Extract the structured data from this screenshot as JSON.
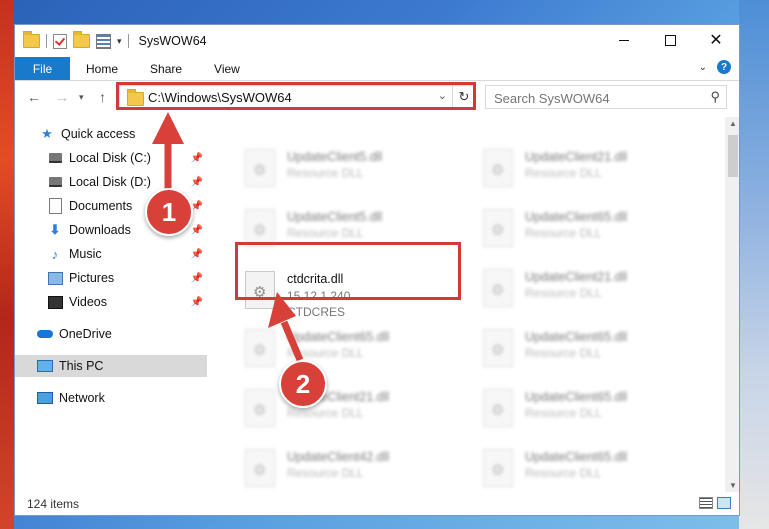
{
  "window": {
    "title": "SysWOW64"
  },
  "ribbon": {
    "tabs": [
      "File",
      "Home",
      "Share",
      "View"
    ],
    "help": "?"
  },
  "address": {
    "path": "C:\\Windows\\SysWOW64"
  },
  "search": {
    "placeholder": "Search SysWOW64"
  },
  "navpane": {
    "items": [
      {
        "label": "Quick access",
        "icon": "star-icon"
      },
      {
        "label": "Local Disk (C:)",
        "icon": "drive-icon",
        "pinned": true
      },
      {
        "label": "Local Disk (D:)",
        "icon": "drive-icon",
        "pinned": true
      },
      {
        "label": "Documents",
        "icon": "document-icon",
        "pinned": true
      },
      {
        "label": "Downloads",
        "icon": "download-icon",
        "pinned": true
      },
      {
        "label": "Music",
        "icon": "music-icon",
        "pinned": true
      },
      {
        "label": "Pictures",
        "icon": "pictures-icon",
        "pinned": true
      },
      {
        "label": "Videos",
        "icon": "video-icon",
        "pinned": true
      },
      {
        "label": "OneDrive",
        "icon": "onedrive-icon"
      },
      {
        "label": "This PC",
        "icon": "pc-icon",
        "selected": true
      },
      {
        "label": "Network",
        "icon": "network-icon"
      }
    ]
  },
  "files": {
    "left": [
      {
        "name": "UpdateClient5.dll",
        "desc": "Resource DLL"
      },
      {
        "name": "UpdateClient5.dll",
        "desc": "Resource DLL"
      },
      {
        "name": "UpdateClient65.dll",
        "desc": "Resource DLL"
      },
      {
        "name": "UpdateClient21.dll",
        "desc": "Resource DLL"
      },
      {
        "name": "UpdateClient42.dll",
        "desc": "Resource DLL"
      }
    ],
    "right": [
      {
        "name": "UpdateClient21.dll",
        "desc": "Resource DLL"
      },
      {
        "name": "UpdateClient65.dll",
        "desc": "Resource DLL"
      },
      {
        "name": "UpdateClient21.dll",
        "desc": "Resource DLL"
      },
      {
        "name": "UpdateClient65.dll",
        "desc": "Resource DLL"
      },
      {
        "name": "UpdateClient65.dll",
        "desc": "Resource DLL"
      },
      {
        "name": "UpdateClient65.dll",
        "desc": "Resource DLL"
      }
    ],
    "highlighted": {
      "name": "ctdcrita.dll",
      "version": "15.12.1.240",
      "company": "CTDCRES"
    }
  },
  "status": {
    "count": "124 items"
  },
  "callouts": {
    "one": "1",
    "two": "2"
  },
  "colors": {
    "accent": "#1979ca",
    "highlight": "#d03a3a"
  }
}
